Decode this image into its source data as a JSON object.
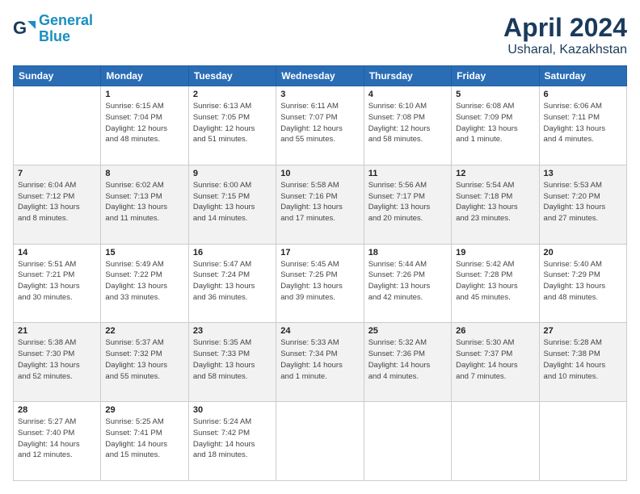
{
  "header": {
    "logo_line1": "General",
    "logo_line2": "Blue",
    "month": "April 2024",
    "location": "Usharal, Kazakhstan"
  },
  "weekdays": [
    "Sunday",
    "Monday",
    "Tuesday",
    "Wednesday",
    "Thursday",
    "Friday",
    "Saturday"
  ],
  "weeks": [
    [
      {
        "day": "",
        "info": ""
      },
      {
        "day": "1",
        "info": "Sunrise: 6:15 AM\nSunset: 7:04 PM\nDaylight: 12 hours\nand 48 minutes."
      },
      {
        "day": "2",
        "info": "Sunrise: 6:13 AM\nSunset: 7:05 PM\nDaylight: 12 hours\nand 51 minutes."
      },
      {
        "day": "3",
        "info": "Sunrise: 6:11 AM\nSunset: 7:07 PM\nDaylight: 12 hours\nand 55 minutes."
      },
      {
        "day": "4",
        "info": "Sunrise: 6:10 AM\nSunset: 7:08 PM\nDaylight: 12 hours\nand 58 minutes."
      },
      {
        "day": "5",
        "info": "Sunrise: 6:08 AM\nSunset: 7:09 PM\nDaylight: 13 hours\nand 1 minute."
      },
      {
        "day": "6",
        "info": "Sunrise: 6:06 AM\nSunset: 7:11 PM\nDaylight: 13 hours\nand 4 minutes."
      }
    ],
    [
      {
        "day": "7",
        "info": "Sunrise: 6:04 AM\nSunset: 7:12 PM\nDaylight: 13 hours\nand 8 minutes."
      },
      {
        "day": "8",
        "info": "Sunrise: 6:02 AM\nSunset: 7:13 PM\nDaylight: 13 hours\nand 11 minutes."
      },
      {
        "day": "9",
        "info": "Sunrise: 6:00 AM\nSunset: 7:15 PM\nDaylight: 13 hours\nand 14 minutes."
      },
      {
        "day": "10",
        "info": "Sunrise: 5:58 AM\nSunset: 7:16 PM\nDaylight: 13 hours\nand 17 minutes."
      },
      {
        "day": "11",
        "info": "Sunrise: 5:56 AM\nSunset: 7:17 PM\nDaylight: 13 hours\nand 20 minutes."
      },
      {
        "day": "12",
        "info": "Sunrise: 5:54 AM\nSunset: 7:18 PM\nDaylight: 13 hours\nand 23 minutes."
      },
      {
        "day": "13",
        "info": "Sunrise: 5:53 AM\nSunset: 7:20 PM\nDaylight: 13 hours\nand 27 minutes."
      }
    ],
    [
      {
        "day": "14",
        "info": "Sunrise: 5:51 AM\nSunset: 7:21 PM\nDaylight: 13 hours\nand 30 minutes."
      },
      {
        "day": "15",
        "info": "Sunrise: 5:49 AM\nSunset: 7:22 PM\nDaylight: 13 hours\nand 33 minutes."
      },
      {
        "day": "16",
        "info": "Sunrise: 5:47 AM\nSunset: 7:24 PM\nDaylight: 13 hours\nand 36 minutes."
      },
      {
        "day": "17",
        "info": "Sunrise: 5:45 AM\nSunset: 7:25 PM\nDaylight: 13 hours\nand 39 minutes."
      },
      {
        "day": "18",
        "info": "Sunrise: 5:44 AM\nSunset: 7:26 PM\nDaylight: 13 hours\nand 42 minutes."
      },
      {
        "day": "19",
        "info": "Sunrise: 5:42 AM\nSunset: 7:28 PM\nDaylight: 13 hours\nand 45 minutes."
      },
      {
        "day": "20",
        "info": "Sunrise: 5:40 AM\nSunset: 7:29 PM\nDaylight: 13 hours\nand 48 minutes."
      }
    ],
    [
      {
        "day": "21",
        "info": "Sunrise: 5:38 AM\nSunset: 7:30 PM\nDaylight: 13 hours\nand 52 minutes."
      },
      {
        "day": "22",
        "info": "Sunrise: 5:37 AM\nSunset: 7:32 PM\nDaylight: 13 hours\nand 55 minutes."
      },
      {
        "day": "23",
        "info": "Sunrise: 5:35 AM\nSunset: 7:33 PM\nDaylight: 13 hours\nand 58 minutes."
      },
      {
        "day": "24",
        "info": "Sunrise: 5:33 AM\nSunset: 7:34 PM\nDaylight: 14 hours\nand 1 minute."
      },
      {
        "day": "25",
        "info": "Sunrise: 5:32 AM\nSunset: 7:36 PM\nDaylight: 14 hours\nand 4 minutes."
      },
      {
        "day": "26",
        "info": "Sunrise: 5:30 AM\nSunset: 7:37 PM\nDaylight: 14 hours\nand 7 minutes."
      },
      {
        "day": "27",
        "info": "Sunrise: 5:28 AM\nSunset: 7:38 PM\nDaylight: 14 hours\nand 10 minutes."
      }
    ],
    [
      {
        "day": "28",
        "info": "Sunrise: 5:27 AM\nSunset: 7:40 PM\nDaylight: 14 hours\nand 12 minutes."
      },
      {
        "day": "29",
        "info": "Sunrise: 5:25 AM\nSunset: 7:41 PM\nDaylight: 14 hours\nand 15 minutes."
      },
      {
        "day": "30",
        "info": "Sunrise: 5:24 AM\nSunset: 7:42 PM\nDaylight: 14 hours\nand 18 minutes."
      },
      {
        "day": "",
        "info": ""
      },
      {
        "day": "",
        "info": ""
      },
      {
        "day": "",
        "info": ""
      },
      {
        "day": "",
        "info": ""
      }
    ]
  ]
}
